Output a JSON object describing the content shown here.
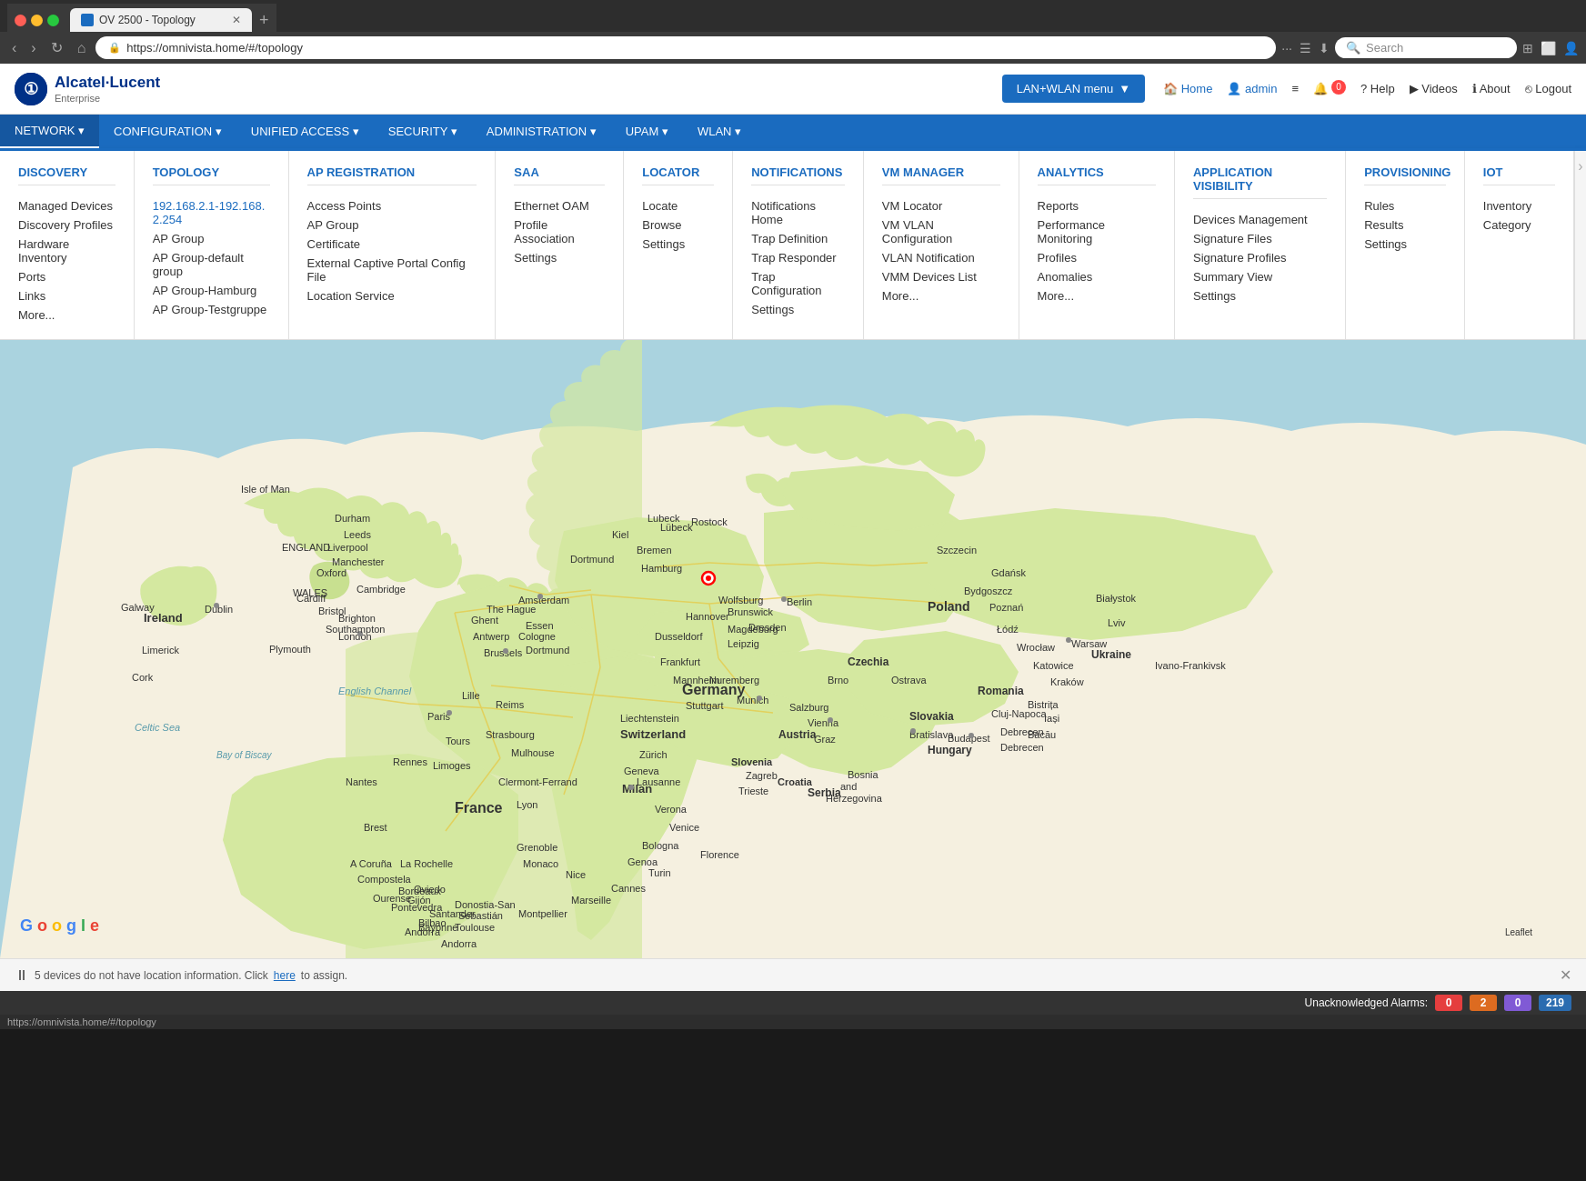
{
  "browser": {
    "tab_title": "OV 2500 - Topology",
    "url": "https://omnivista.home/#/topology",
    "new_tab_label": "+",
    "search_placeholder": "Search"
  },
  "header": {
    "logo_name": "Alcatel·Lucent",
    "logo_sub": "Enterprise",
    "logo_icon_text": "①",
    "lan_wlan_btn": "LAN+WLAN menu",
    "nav_items": [
      {
        "label": "Home",
        "icon": "🏠",
        "type": "home"
      },
      {
        "label": "admin",
        "icon": "👤",
        "type": "admin"
      },
      {
        "label": "≡",
        "type": "menu"
      },
      {
        "label": "🔔",
        "badge": "0",
        "type": "bell"
      },
      {
        "label": "? Help",
        "type": "help"
      },
      {
        "label": "▶ Videos",
        "type": "videos"
      },
      {
        "label": "ℹ About",
        "type": "about"
      },
      {
        "label": "⎋ Logout",
        "type": "logout"
      }
    ]
  },
  "main_nav": {
    "items": [
      {
        "label": "NETWORK",
        "active": true,
        "has_arrow": true
      },
      {
        "label": "CONFIGURATION",
        "has_arrow": true
      },
      {
        "label": "UNIFIED ACCESS",
        "has_arrow": true
      },
      {
        "label": "SECURITY",
        "has_arrow": true
      },
      {
        "label": "ADMINISTRATION",
        "has_arrow": true
      },
      {
        "label": "UPAM",
        "has_arrow": true
      },
      {
        "label": "WLAN",
        "has_arrow": true
      }
    ]
  },
  "dropdown": {
    "columns": [
      {
        "title": "DISCOVERY",
        "items": [
          "Managed Devices",
          "Discovery Profiles",
          "Hardware Inventory",
          "Ports",
          "Links",
          "More..."
        ]
      },
      {
        "title": "TOPOLOGY",
        "items": [
          "192.168.2.1-192.168.2.254",
          "AP Group",
          "AP Group-default group",
          "AP Group-Hamburg",
          "AP Group-Testgruppe"
        ]
      },
      {
        "title": "AP REGISTRATION",
        "items": [
          "Access Points",
          "AP Group",
          "Certificate",
          "External Captive Portal Config File",
          "Location Service"
        ]
      },
      {
        "title": "SAA",
        "items": [
          "Ethernet OAM",
          "Profile Association",
          "Settings"
        ]
      },
      {
        "title": "LOCATOR",
        "items": [
          "Locate",
          "Browse",
          "Settings"
        ]
      },
      {
        "title": "NOTIFICATIONS",
        "items": [
          "Notifications Home",
          "Trap Definition",
          "Trap Responder",
          "Trap Configuration",
          "Settings"
        ]
      },
      {
        "title": "VM MANAGER",
        "items": [
          "VM Locator",
          "VM VLAN Configuration",
          "VLAN Notification",
          "VMM Devices List",
          "More..."
        ]
      },
      {
        "title": "ANALYTICS",
        "items": [
          "Reports",
          "Performance Monitoring",
          "Profiles",
          "Anomalies",
          "More..."
        ]
      },
      {
        "title": "APPLICATION VISIBILITY",
        "items": [
          "Devices Management",
          "Signature Files",
          "Signature Profiles",
          "Summary View",
          "Settings"
        ]
      },
      {
        "title": "PROVISIONING",
        "items": [
          "Rules",
          "Results",
          "Settings"
        ]
      },
      {
        "title": "IoT",
        "items": [
          "Inventory",
          "Category"
        ]
      }
    ]
  },
  "bottom_notification": {
    "text": "5 devices do not have location information. Click",
    "link_text": "here",
    "text_after": "to assign."
  },
  "alarms": {
    "label": "Unacknowledged Alarms:",
    "items": [
      {
        "count": "0",
        "color": "red"
      },
      {
        "count": "2",
        "color": "orange"
      },
      {
        "count": "0",
        "color": "purple"
      },
      {
        "count": "219",
        "color": "blue"
      }
    ]
  },
  "status_bar": {
    "url": "https://omnivista.home/#/topology"
  }
}
